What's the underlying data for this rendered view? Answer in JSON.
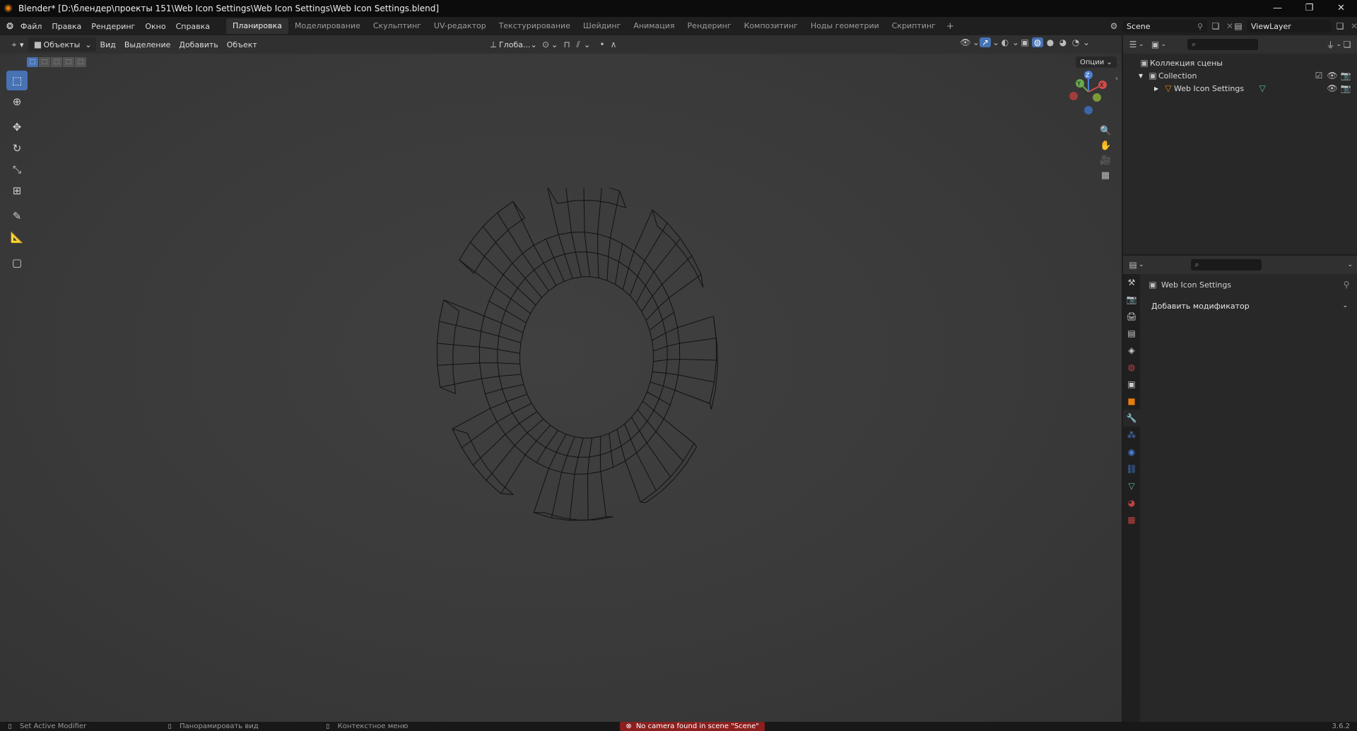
{
  "window": {
    "title": "Blender* [D:\\блендер\\проекты 151\\Web Icon Settings\\Web Icon Settings\\Web Icon Settings.blend]",
    "controls": [
      "—",
      "❐",
      "✕"
    ]
  },
  "menu": {
    "items": [
      "Файл",
      "Правка",
      "Рендеринг",
      "Окно",
      "Справка"
    ]
  },
  "workspaces": {
    "tabs": [
      "Планировка",
      "Моделирование",
      "Скульптинг",
      "UV-редактор",
      "Текстурирование",
      "Шейдинг",
      "Анимация",
      "Рендеринг",
      "Композитинг",
      "Ноды геометрии",
      "Скриптинг"
    ],
    "active": "Планировка",
    "add": "+"
  },
  "scene": {
    "name": "Scene"
  },
  "viewlayer": {
    "name": "ViewLayer"
  },
  "viewport_header": {
    "mode": "Объекты",
    "menus": [
      "Вид",
      "Выделение",
      "Добавить",
      "Объект"
    ],
    "transform": "Глоба...",
    "options": "Опции"
  },
  "gizmo": {
    "x": "X",
    "y": "Y",
    "z": "Z"
  },
  "outliner": {
    "root": "Коллекция сцены",
    "collection": "Collection",
    "object": "Web Icon Settings"
  },
  "properties": {
    "object": "Web Icon Settings",
    "add_modifier": "Добавить модификатор"
  },
  "status": {
    "left": "Set Active Modifier",
    "middle": "Панорамировать вид",
    "right": "Контекстное меню",
    "warning": "No camera found in scene \"Scene\"",
    "version": "3.6.2"
  },
  "colors": {
    "accent": "#4772b3",
    "brand": "#e87d0d",
    "warning": "#8b1f1f",
    "mesh_wire": "#111111"
  }
}
